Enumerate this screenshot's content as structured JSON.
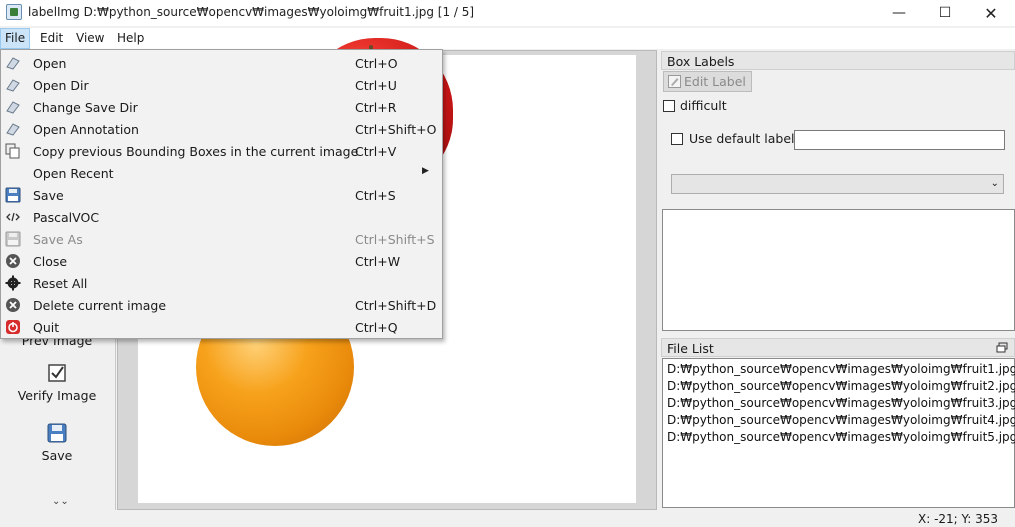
{
  "window": {
    "title": "labelImg D:₩python_source₩opencv₩images₩yoloimg₩fruit1.jpg [1 / 5]",
    "minimize": "—",
    "maximize": "☐",
    "close": "✕"
  },
  "menubar": {
    "file": "File",
    "edit": "Edit",
    "view": "View",
    "help": "Help"
  },
  "file_menu": {
    "items": [
      {
        "label": "Open",
        "shortcut": "Ctrl+O",
        "icon": "open-folder-icon"
      },
      {
        "label": "Open Dir",
        "shortcut": "Ctrl+U",
        "icon": "open-dir-icon"
      },
      {
        "label": "Change Save Dir",
        "shortcut": "Ctrl+R",
        "icon": "change-save-dir-icon"
      },
      {
        "label": "Open Annotation",
        "shortcut": "Ctrl+Shift+O",
        "icon": "open-annotation-icon"
      },
      {
        "label": "Copy previous Bounding Boxes in the current image",
        "shortcut": "Ctrl+V",
        "icon": "copy-icon"
      },
      {
        "label": "Open Recent",
        "shortcut": "",
        "icon": "",
        "submenu": true
      },
      {
        "label": "Save",
        "shortcut": "Ctrl+S",
        "icon": "save-icon"
      },
      {
        "label": "PascalVOC",
        "shortcut": "",
        "icon": "format-icon"
      },
      {
        "label": "Save As",
        "shortcut": "Ctrl+Shift+S",
        "icon": "save-as-icon",
        "disabled": true
      },
      {
        "label": "Close",
        "shortcut": "Ctrl+W",
        "icon": "close-icon"
      },
      {
        "label": "Reset All",
        "shortcut": "",
        "icon": "gear-icon"
      },
      {
        "label": "Delete current image",
        "shortcut": "Ctrl+Shift+D",
        "icon": "delete-icon"
      },
      {
        "label": "Quit",
        "shortcut": "Ctrl+Q",
        "icon": "quit-icon"
      }
    ]
  },
  "toolbar": {
    "prev_image": "Prev Image",
    "verify_image": "Verify Image",
    "save": "Save"
  },
  "box_labels": {
    "header": "Box Labels",
    "edit_label": "Edit Label",
    "difficult": "difficult",
    "use_default_label": "Use default label",
    "default_label_value": ""
  },
  "file_list": {
    "header": "File List",
    "items": [
      "D:₩python_source₩opencv₩images₩yoloimg₩fruit1.jpg",
      "D:₩python_source₩opencv₩images₩yoloimg₩fruit2.jpg",
      "D:₩python_source₩opencv₩images₩yoloimg₩fruit3.jpg",
      "D:₩python_source₩opencv₩images₩yoloimg₩fruit4.jpg",
      "D:₩python_source₩opencv₩images₩yoloimg₩fruit5.jpg"
    ]
  },
  "status": {
    "coords": "X: -21; Y: 353"
  }
}
